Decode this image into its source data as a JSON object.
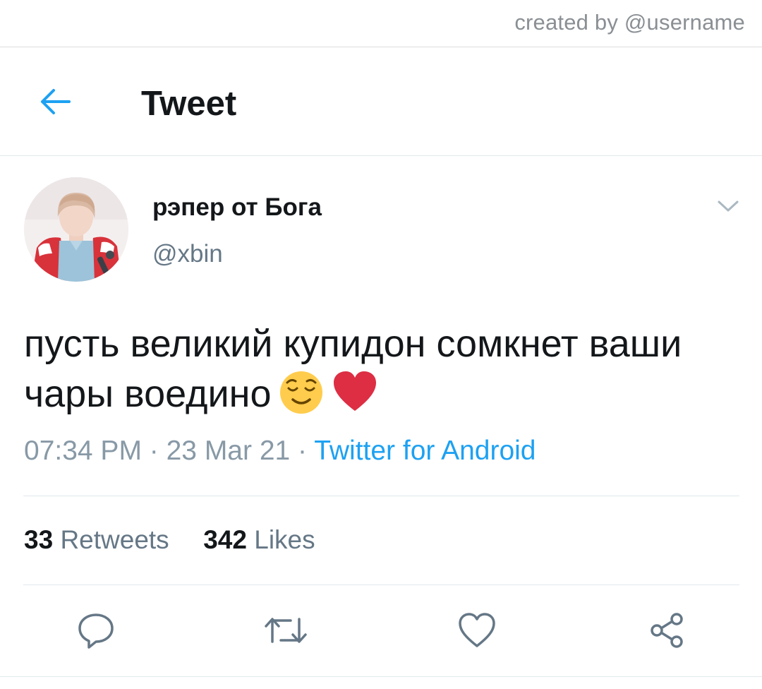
{
  "watermark": "created by @username",
  "header": {
    "title": "Tweet",
    "back_icon": "arrow-left-icon"
  },
  "tweet": {
    "author": {
      "display_name": "рэпер от Бога",
      "handle": "@xbin"
    },
    "text": "пусть великий купидон сомкнет ваши чары воедино",
    "emojis": [
      "relieved-face",
      "red-heart"
    ],
    "timestamp": "07:34 PM",
    "date": "23 Mar 21",
    "separator": " · ",
    "source": "Twitter for Android",
    "stats": {
      "retweets_count": "33",
      "retweets_label": "Retweets",
      "likes_count": "342",
      "likes_label": "Likes"
    },
    "actions": [
      "reply-icon",
      "retweet-icon",
      "like-icon",
      "share-icon"
    ]
  },
  "colors": {
    "accent": "#1da1f2",
    "text_primary": "#14171a",
    "text_secondary": "#657786",
    "meta_gray": "#8899a6",
    "divider": "#e1e8ed"
  }
}
